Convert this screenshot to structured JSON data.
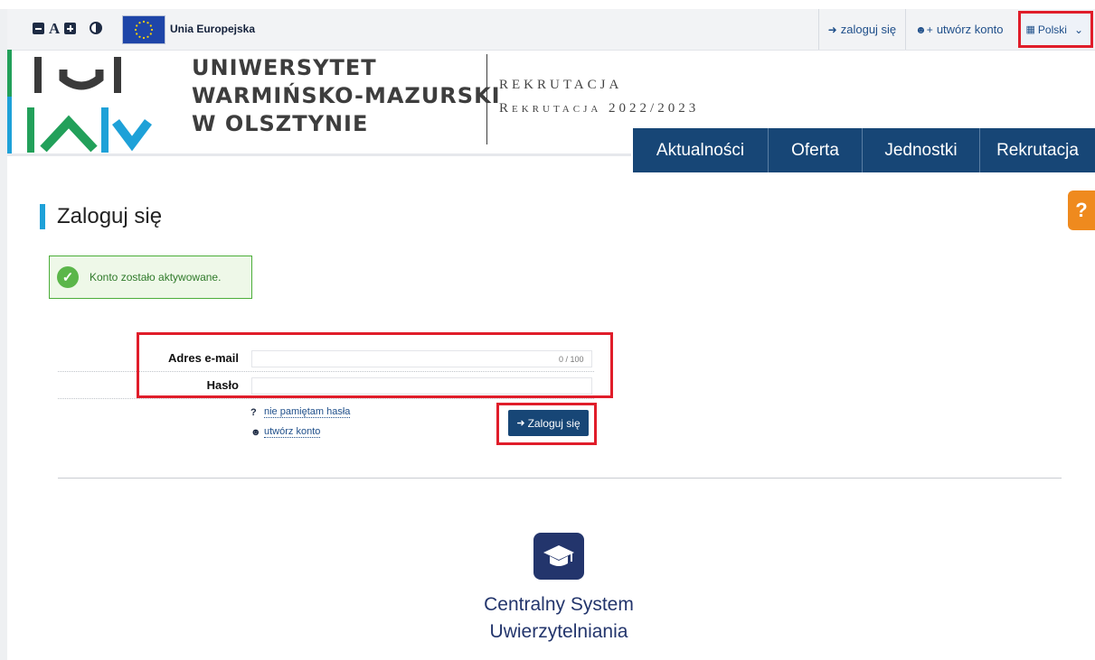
{
  "topbar": {
    "a11y_letter": "A",
    "eu_label": "Unia Europejska",
    "login_link": "zaloguj się",
    "create_account_link": "utwórz konto",
    "language": "Polski"
  },
  "header": {
    "university_line1": "UNIWERSYTET",
    "university_line2": "WARMIŃSKO-MAZURSKI",
    "university_line3": "W OLSZTYNIE",
    "section_line1": "Rekrutacja",
    "section_line2": "Rekrutacja 2022/2023"
  },
  "nav": {
    "items": [
      "Aktualności",
      "Oferta",
      "Jednostki",
      "Rekrutacja"
    ]
  },
  "help": {
    "label": "?"
  },
  "page": {
    "title": "Zaloguj się",
    "success_message": "Konto zostało aktywowane."
  },
  "form": {
    "email_label": "Adres e-mail",
    "email_value": "",
    "email_counter": "0 / 100",
    "password_label": "Hasło",
    "password_value": "",
    "forgot_icon": "?",
    "forgot_link": "nie pamiętam hasła",
    "create_account_link": "utwórz konto",
    "submit_label": "Zaloguj się"
  },
  "cas": {
    "title_line1": "Centralny System",
    "title_line2": "Uwierzytelniania"
  },
  "colors": {
    "navy": "#174676",
    "accent_blue": "#1ea1d8",
    "green": "#22a05a",
    "highlight_red": "#e01d2a",
    "help_orange": "#ef8a1e",
    "cas_navy": "#23356c"
  },
  "icons": {
    "font_decrease": "minus-square-icon",
    "font_increase": "plus-square-icon",
    "contrast": "contrast-icon",
    "login": "sign-in-icon",
    "add_user": "user-plus-icon",
    "language": "translate-icon",
    "dropdown": "chevron-down-icon",
    "success": "check-circle-icon",
    "cas": "graduation-cap-icon"
  }
}
